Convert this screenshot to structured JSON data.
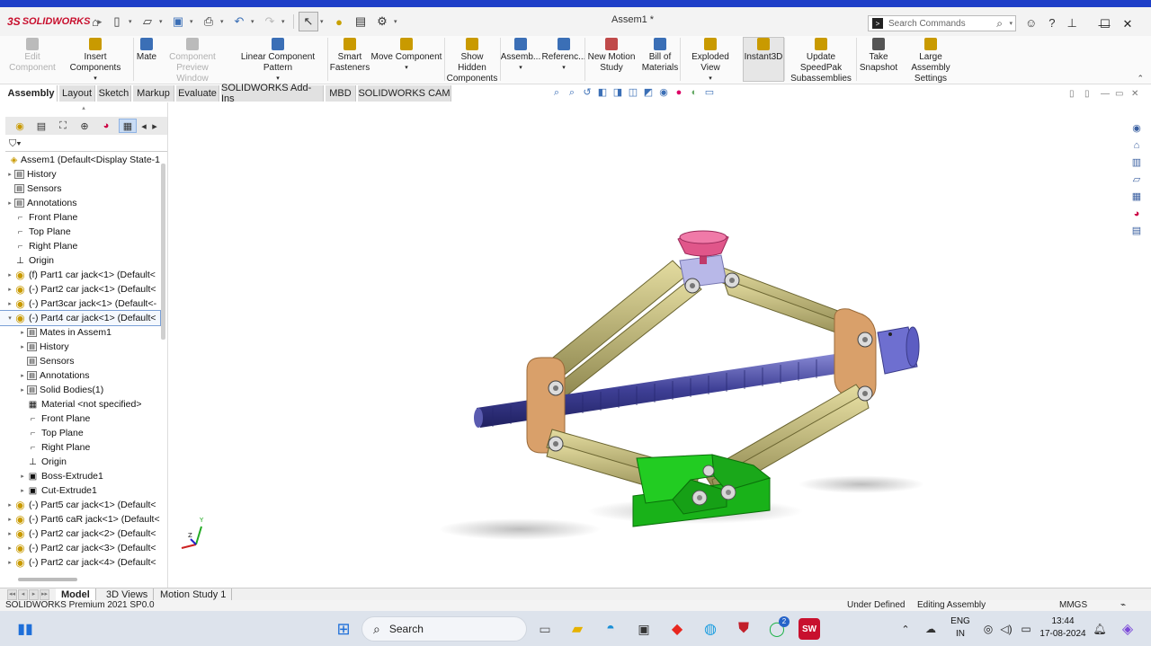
{
  "app": {
    "logo": "SOLIDWORKS",
    "document_title": "Assem1 *",
    "search_placeholder": "Search Commands"
  },
  "ribbon": [
    {
      "label": "Edit\nComponent",
      "disabled": true
    },
    {
      "label": "Insert Components",
      "disabled": false
    },
    {
      "label": "Mate",
      "disabled": false
    },
    {
      "label": "Component\nPreview Window",
      "disabled": true
    },
    {
      "label": "Linear Component Pattern",
      "disabled": false
    },
    {
      "label": "Smart\nFasteners",
      "disabled": false
    },
    {
      "label": "Move Component",
      "disabled": false
    },
    {
      "label": "Show Hidden\nComponents",
      "disabled": false
    },
    {
      "label": "Assemb...",
      "disabled": false
    },
    {
      "label": "Referenc...",
      "disabled": false
    },
    {
      "label": "New Motion\nStudy",
      "disabled": false
    },
    {
      "label": "Bill of\nMaterials",
      "disabled": false
    },
    {
      "label": "Exploded View",
      "disabled": false
    },
    {
      "label": "Instant3D",
      "disabled": false,
      "active": true
    },
    {
      "label": "Update SpeedPak\nSubassemblies",
      "disabled": false
    },
    {
      "label": "Take\nSnapshot",
      "disabled": false
    },
    {
      "label": "Large Assembly\nSettings",
      "disabled": false
    }
  ],
  "tabs": [
    "Assembly",
    "Layout",
    "Sketch",
    "Markup",
    "Evaluate",
    "SOLIDWORKS Add-Ins",
    "MBD",
    "SOLIDWORKS CAM"
  ],
  "active_tab": "Assembly",
  "tree": [
    {
      "label": "Assem1  (Default<Display State-1",
      "level": 0,
      "exp": "",
      "icon": "assembly"
    },
    {
      "label": "History",
      "level": 1,
      "exp": "▸",
      "icon": "box"
    },
    {
      "label": "Sensors",
      "level": 1,
      "exp": "",
      "icon": "box"
    },
    {
      "label": "Annotations",
      "level": 1,
      "exp": "▸",
      "icon": "box"
    },
    {
      "label": "Front Plane",
      "level": 1,
      "exp": "",
      "icon": "plane"
    },
    {
      "label": "Top Plane",
      "level": 1,
      "exp": "",
      "icon": "plane"
    },
    {
      "label": "Right Plane",
      "level": 1,
      "exp": "",
      "icon": "plane"
    },
    {
      "label": "Origin",
      "level": 1,
      "exp": "",
      "icon": "origin"
    },
    {
      "label": "(f) Part1 car jack<1> (Default<",
      "level": 1,
      "exp": "▸",
      "icon": "part"
    },
    {
      "label": "(-) Part2 car jack<1> (Default<",
      "level": 1,
      "exp": "▸",
      "icon": "part"
    },
    {
      "label": "(-) Part3car jack<1> (Default<-",
      "level": 1,
      "exp": "▸",
      "icon": "part"
    },
    {
      "label": "(-) Part4 car jack<1> (Default<",
      "level": 1,
      "exp": "▾",
      "icon": "part",
      "selected": true
    },
    {
      "label": "Mates in Assem1",
      "level": 2,
      "exp": "▸",
      "icon": "box"
    },
    {
      "label": "History",
      "level": 2,
      "exp": "▸",
      "icon": "box"
    },
    {
      "label": "Sensors",
      "level": 2,
      "exp": "",
      "icon": "box"
    },
    {
      "label": "Annotations",
      "level": 2,
      "exp": "▸",
      "icon": "box"
    },
    {
      "label": "Solid Bodies(1)",
      "level": 2,
      "exp": "▸",
      "icon": "box"
    },
    {
      "label": "Material <not specified>",
      "level": 2,
      "exp": "",
      "icon": "material"
    },
    {
      "label": "Front Plane",
      "level": 2,
      "exp": "",
      "icon": "plane"
    },
    {
      "label": "Top Plane",
      "level": 2,
      "exp": "",
      "icon": "plane"
    },
    {
      "label": "Right Plane",
      "level": 2,
      "exp": "",
      "icon": "plane"
    },
    {
      "label": "Origin",
      "level": 2,
      "exp": "",
      "icon": "origin"
    },
    {
      "label": "Boss-Extrude1",
      "level": 2,
      "exp": "▸",
      "icon": "feature"
    },
    {
      "label": "Cut-Extrude1",
      "level": 2,
      "exp": "▸",
      "icon": "feature"
    },
    {
      "label": "(-) Part5 car jack<1> (Default<",
      "level": 1,
      "exp": "▸",
      "icon": "part"
    },
    {
      "label": "(-) Part6 caR jack<1> (Default<",
      "level": 1,
      "exp": "▸",
      "icon": "part"
    },
    {
      "label": "(-) Part2 car jack<2> (Default<",
      "level": 1,
      "exp": "▸",
      "icon": "part"
    },
    {
      "label": "(-) Part2 car jack<3> (Default<",
      "level": 1,
      "exp": "▸",
      "icon": "part"
    },
    {
      "label": "(-) Part2 car jack<4> (Default<",
      "level": 1,
      "exp": "▸",
      "icon": "part"
    }
  ],
  "bottom_tabs": [
    "Model",
    "3D Views",
    "Motion Study 1"
  ],
  "status": {
    "product": "SOLIDWORKS Premium 2021 SP0.0",
    "state": "Under Defined",
    "mode": "Editing Assembly",
    "units": "MMGS"
  },
  "taskbar": {
    "search_label": "Search",
    "lang1": "ENG",
    "lang2": "IN",
    "time": "13:44",
    "date": "17-08-2024",
    "whatsapp_badge": "2"
  },
  "colors": {
    "accent": "#1e3fc8",
    "arm": "#c8c07a",
    "screw": "#3e3f95",
    "base": "#1ec21e",
    "bracket": "#d9a06a",
    "saddle": "#e0568a"
  },
  "triad": {
    "y": "Y",
    "z": "Z"
  }
}
